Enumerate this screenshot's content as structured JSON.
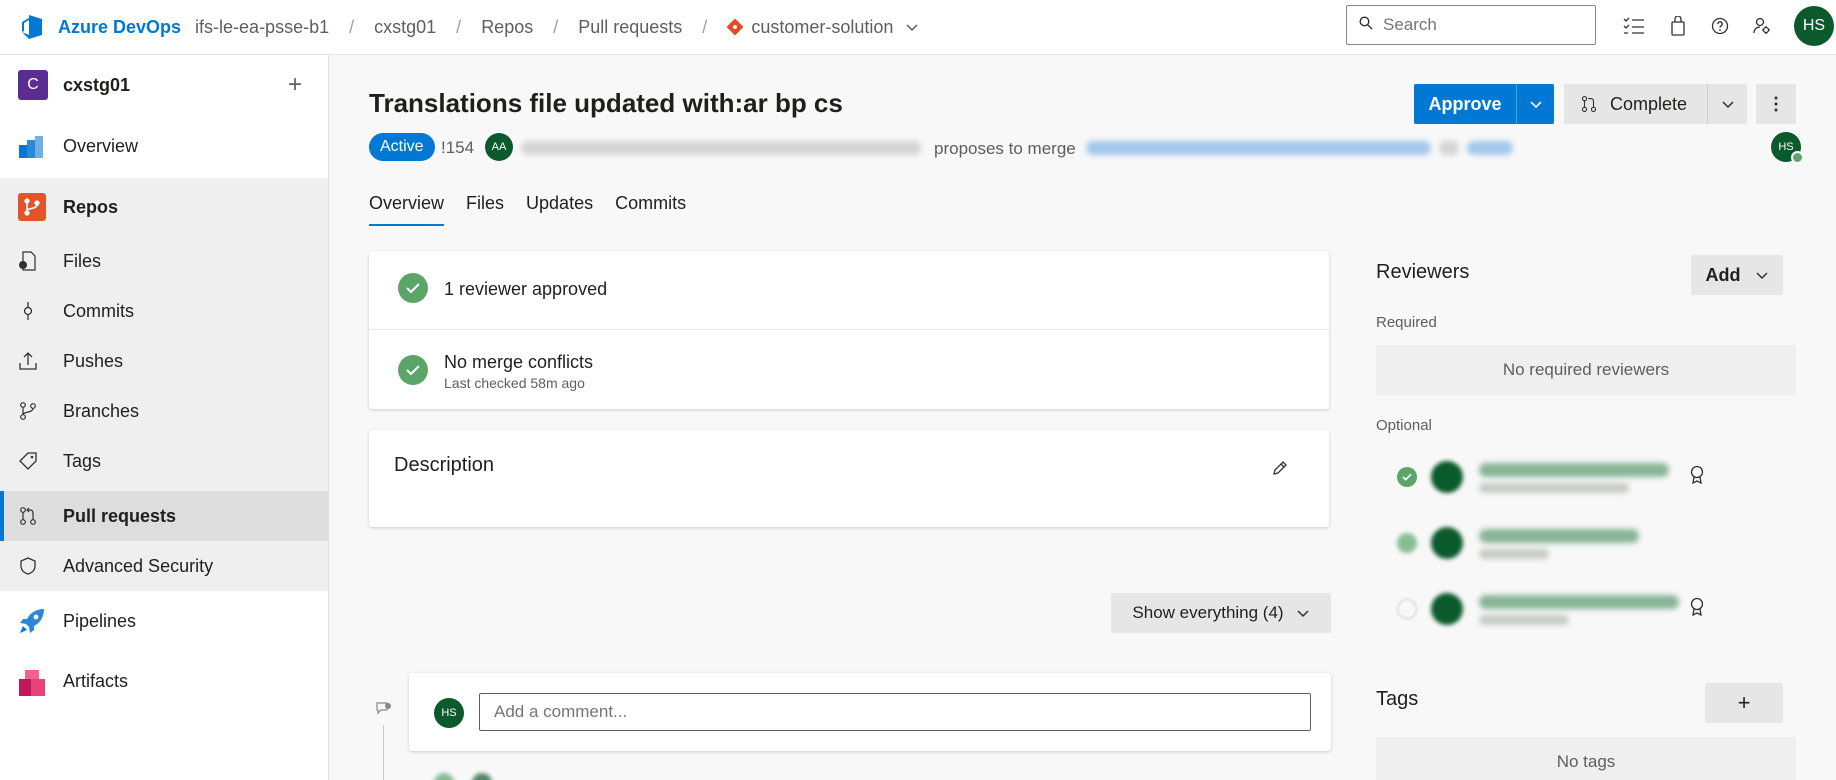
{
  "topbar": {
    "brand": "Azure DevOps",
    "breadcrumbs": [
      "ifs-le-ea-psse-b1",
      "cxstg01",
      "Repos",
      "Pull requests",
      "customer-solution"
    ],
    "search_placeholder": "Search",
    "user_initials": "HS"
  },
  "sidebar": {
    "project_initial": "C",
    "project_name": "cxstg01",
    "items": [
      {
        "label": "Overview"
      },
      {
        "label": "Repos"
      },
      {
        "label": "Files"
      },
      {
        "label": "Commits"
      },
      {
        "label": "Pushes"
      },
      {
        "label": "Branches"
      },
      {
        "label": "Tags"
      },
      {
        "label": "Pull requests"
      },
      {
        "label": "Advanced Security"
      },
      {
        "label": "Pipelines"
      },
      {
        "label": "Artifacts"
      }
    ]
  },
  "pr": {
    "title": "Translations file updated with:ar bp cs",
    "status": "Active",
    "id": "!154",
    "author_initials": "AA",
    "proposes_text": "proposes to merge",
    "approve_label": "Approve",
    "complete_label": "Complete",
    "tabs": [
      "Overview",
      "Files",
      "Updates",
      "Commits"
    ],
    "checks": [
      {
        "title": "1 reviewer approved",
        "subtitle": ""
      },
      {
        "title": "No merge conflicts",
        "subtitle": "Last checked 58m ago"
      }
    ],
    "description_title": "Description",
    "show_filter": "Show everything (4)",
    "comment_placeholder": "Add a comment...",
    "commenter_initials": "HS"
  },
  "reviewers": {
    "title": "Reviewers",
    "add_label": "Add",
    "required_label": "Required",
    "no_required": "No required reviewers",
    "optional_label": "Optional"
  },
  "tags": {
    "title": "Tags",
    "empty": "No tags"
  },
  "colors": {
    "accent": "#0078d4",
    "success": "#5aa567",
    "avatar": "#0b5a2c"
  }
}
